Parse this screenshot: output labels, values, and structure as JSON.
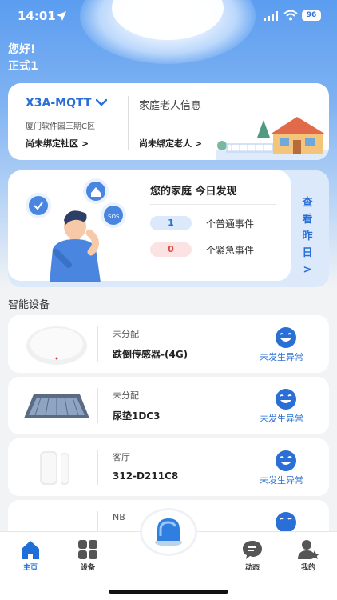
{
  "status_bar": {
    "time": "14:01",
    "battery": "96"
  },
  "greeting": {
    "line1": "您好!",
    "line2": "正式1"
  },
  "info_card": {
    "device_name": "X3A-MQTT",
    "address": "厦门软件园三期C区",
    "community_link": "尚未绑定社区 >",
    "elder_title": "家庭老人信息",
    "elder_link": "尚未绑定老人 >"
  },
  "events": {
    "title": "您的家庭 今日发现",
    "normal_count": "1",
    "normal_label": "个普通事件",
    "urgent_count": "0",
    "urgent_label": "个紧急事件",
    "yesterday": [
      "查",
      "看",
      "昨",
      "日",
      ">"
    ]
  },
  "section_title": "智能设备",
  "devices": [
    {
      "location": "未分配",
      "name": "跌倒传感器-(4G)",
      "status": "未发生异常",
      "thumb": "sensor-puck"
    },
    {
      "location": "未分配",
      "name": "尿垫1DC3",
      "status": "未发生异常",
      "thumb": "mat"
    },
    {
      "location": "客厅",
      "name": "312-D211C8",
      "status": "未发生异常",
      "thumb": "door-sensor"
    },
    {
      "location": "NB",
      "name": "",
      "status": "",
      "thumb": "device"
    }
  ],
  "tabs": [
    {
      "label": "主页",
      "icon": "home-icon",
      "active": true
    },
    {
      "label": "设备",
      "icon": "grid-icon",
      "active": false
    },
    {
      "label": "动态",
      "icon": "chat-icon",
      "active": false
    },
    {
      "label": "我的",
      "icon": "user-icon",
      "active": false
    }
  ],
  "colors": {
    "accent": "#2a6fd6",
    "urgent": "#e0443e",
    "background": "#f2f3f5"
  }
}
